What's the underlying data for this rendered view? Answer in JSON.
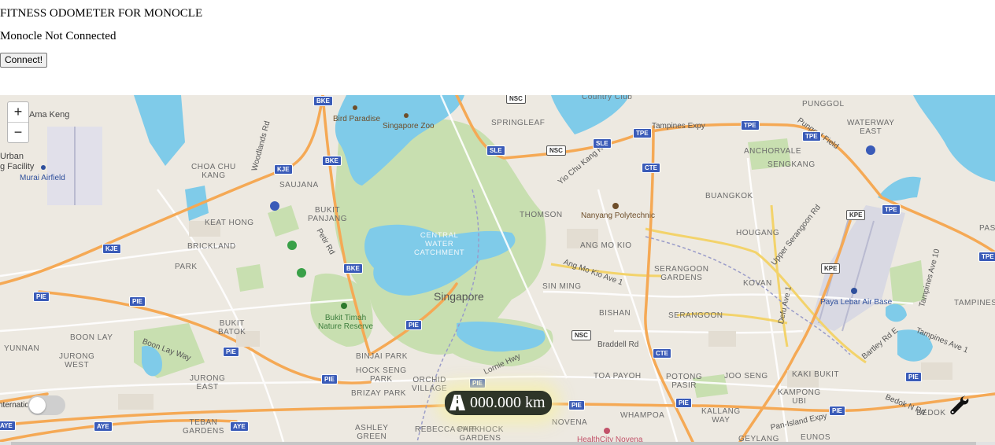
{
  "app": {
    "title": "FITNESS ODOMETER FOR MONOCLE",
    "status": "Monocle Not Connected",
    "connect_label": "Connect!"
  },
  "map": {
    "zoom_in": "+",
    "zoom_out": "−",
    "colors": {
      "water": "#7fcbe9",
      "park": "#c8dfb0",
      "expressway": "#f5a955",
      "land": "#ede9e1"
    },
    "labels": {
      "singapore": "Singapore",
      "central_water": "CENTRAL\nWATER\nCATCHMENT",
      "bukit_timah": "Bukit Timah\nNature Reserve",
      "bird_paradise": "Bird Paradise",
      "singapore_zoo": "Singapore Zoo",
      "nanyang": "Nanyang Polytechnic",
      "paya_lebar": "Paya Lebar Air Base",
      "murai": "Murai Airfield",
      "urban": "Urban",
      "facility": "g Facility",
      "ama_keng": "Ama Keng",
      "country_club": "Country Club",
      "healthcity": "HealthCity Novena",
      "springleaf": "SPRINGLEAF",
      "choa_chu_kang": "CHOA CHU\nKANG",
      "saujana": "SAUJANA",
      "bukit_panjang": "BUKIT\nPANJANG",
      "keat_hong": "KEAT HONG",
      "brickland": "BRICKLAND",
      "park": "PARK",
      "thomson": "THOMSON",
      "ang_mo_kio": "ANG MO KIO",
      "sin_ming": "SIN MING",
      "bishan": "BISHAN",
      "serangoon_gardens": "SERANGOON\nGARDENS",
      "kovan": "KOVAN",
      "hougang": "HOUGANG",
      "buangkok": "BUANGKOK",
      "sengkang": "SENGKANG",
      "anchorvale": "ANCHORVALE",
      "punggol": "PUNGGOL",
      "waterway_east": "WATERWAY\nEAST",
      "pas": "PAS",
      "tampines": "TAMPINES",
      "serangoon": "SERANGOON",
      "bukit_batok": "BUKIT\nBATOK",
      "boon_lay": "BOON LAY",
      "jurong_west": "JURONG\nWEST",
      "yunnan": "YUNNAN",
      "jurong_east": "JURONG\nEAST",
      "teban_gardens": "TEBAN\nGARDENS",
      "binjai_park": "BINJAI PARK",
      "hock_seng_park": "HOCK SENG\nPARK",
      "brizay_park": "BRIZAY PARK",
      "orchid_village": "ORCHID\nVILLAGE",
      "ashley_green": "ASHLEY\nGREEN",
      "rebecca_park": "REBECCA PARK",
      "chip_hock_gardens": "CHIP HOCK\nGARDENS",
      "toa_payoh": "TOA PAYOH",
      "potong_pasir": "POTONG\nPASIR",
      "joo_seng": "JOO SENG",
      "kaki_bukit": "KAKI BUKIT",
      "kampong_ubi": "KAMPONG\nUBI",
      "kallang_way": "KALLANG\nWAY",
      "whampoa": "WHAMPOA",
      "novena": "NOVENA",
      "bedok": "BEDOK",
      "eunos": "EUNOS",
      "geylang": "GEYLANG"
    },
    "roads": {
      "tampines_expy": "Tampines Expy",
      "yio_chu_kang_rd": "Yio Chu Kang Rd",
      "ang_mo_kio_ave_1": "Ang Mo Kio Ave 1",
      "braddell_rd": "Braddell Rd",
      "lornie_hwy": "Lornie Hwy",
      "boon_lay_way": "Boon Lay Way",
      "woodlands_rd": "Woodlands Rd",
      "petir_rd": "Petir Rd",
      "upper_serangoon_rd": "Upper Serangoon Rd",
      "defu_ave_1": "Defu Ave 1",
      "tampines_ave_10": "Tampines Ave 10",
      "tampines_ave_1": "Tampines Ave 1",
      "bartley_rd_e": "Bartley Rd E",
      "bedok_n_rd": "Bedok N Rd",
      "pan_island_expy": "Pan-Island Expy",
      "punggol_field": "Punggol Field"
    },
    "shields": {
      "bke": "BKE",
      "kje": "KJE",
      "pie": "PIE",
      "nsc": "NSC",
      "sle": "SLE",
      "tpe": "TPE",
      "cte": "CTE",
      "kpe": "KPE",
      "aye": "AYE"
    }
  },
  "overlay": {
    "toggle_label": "nternatio",
    "toggle_on": false,
    "odometer": "000.000 km",
    "road_icon": "road-icon",
    "settings_icon": "wrench-icon"
  }
}
